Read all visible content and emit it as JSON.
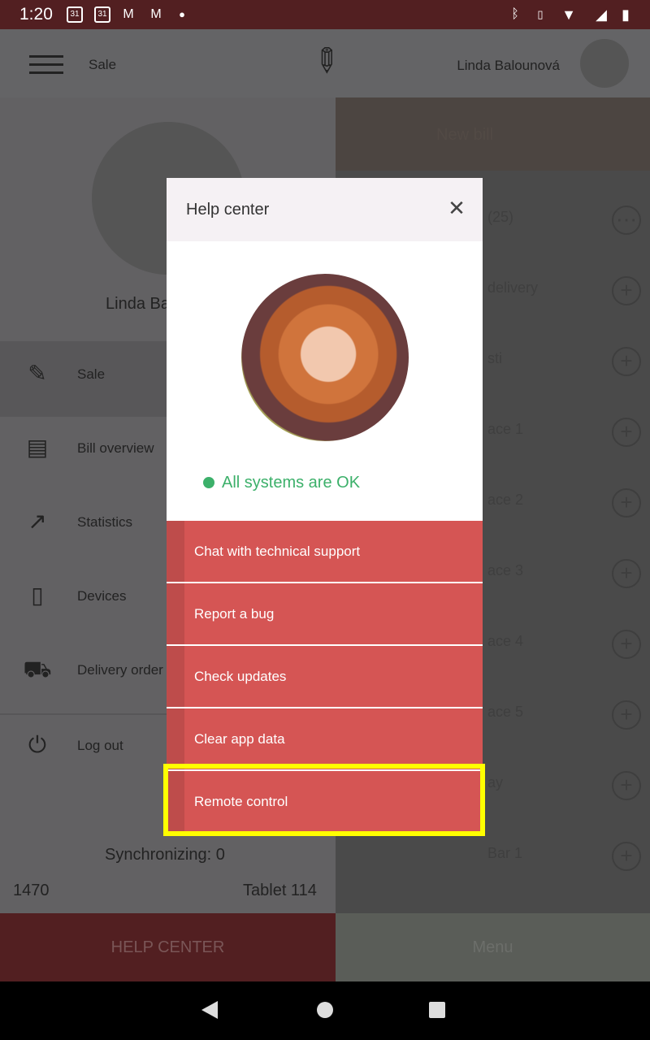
{
  "status_bar": {
    "time": "1:20",
    "left_icons": [
      "calendar-icon",
      "calendar-icon",
      "gmail-icon",
      "gmail-icon",
      "dot-icon"
    ],
    "calendar_day": "31",
    "right_icons": [
      "bluetooth-icon",
      "vibrate-icon",
      "wifi-icon",
      "signal-icon",
      "battery-charging-icon"
    ]
  },
  "header": {
    "title": "Sale",
    "user_name": "Linda Balounová"
  },
  "drawer": {
    "user_name": "Linda Ba",
    "items": [
      {
        "label": "Sale",
        "icon": "pen-fork-icon"
      },
      {
        "label": "Bill overview",
        "icon": "documents-icon"
      },
      {
        "label": "Statistics",
        "icon": "trend-icon"
      },
      {
        "label": "Devices",
        "icon": "tablet-icon"
      },
      {
        "label": "Delivery order",
        "icon": "car-icon"
      },
      {
        "label": "Log out",
        "icon": "power-icon"
      }
    ],
    "sync": "Synchronizing: 0",
    "left_footer": "1470",
    "right_footer": "Tablet 114",
    "help_button": "HELP CENTER"
  },
  "right_panel": {
    "new_bill": "New bill",
    "rows": [
      "(25)",
      "delivery",
      "sti",
      "ace 1",
      "ace 2",
      "ace 3",
      "ace 4",
      "ace 5",
      "ay",
      "Bar 1"
    ],
    "menu_button": "Menu"
  },
  "dialog": {
    "title": "Help center",
    "status": "All systems are OK",
    "status_color": "#3cb06a",
    "buttons": [
      "Chat with technical support",
      "Report a bug",
      "Check updates",
      "Clear app data",
      "Remote control"
    ],
    "highlighted": "Remote control",
    "button_color": "#d55554"
  }
}
